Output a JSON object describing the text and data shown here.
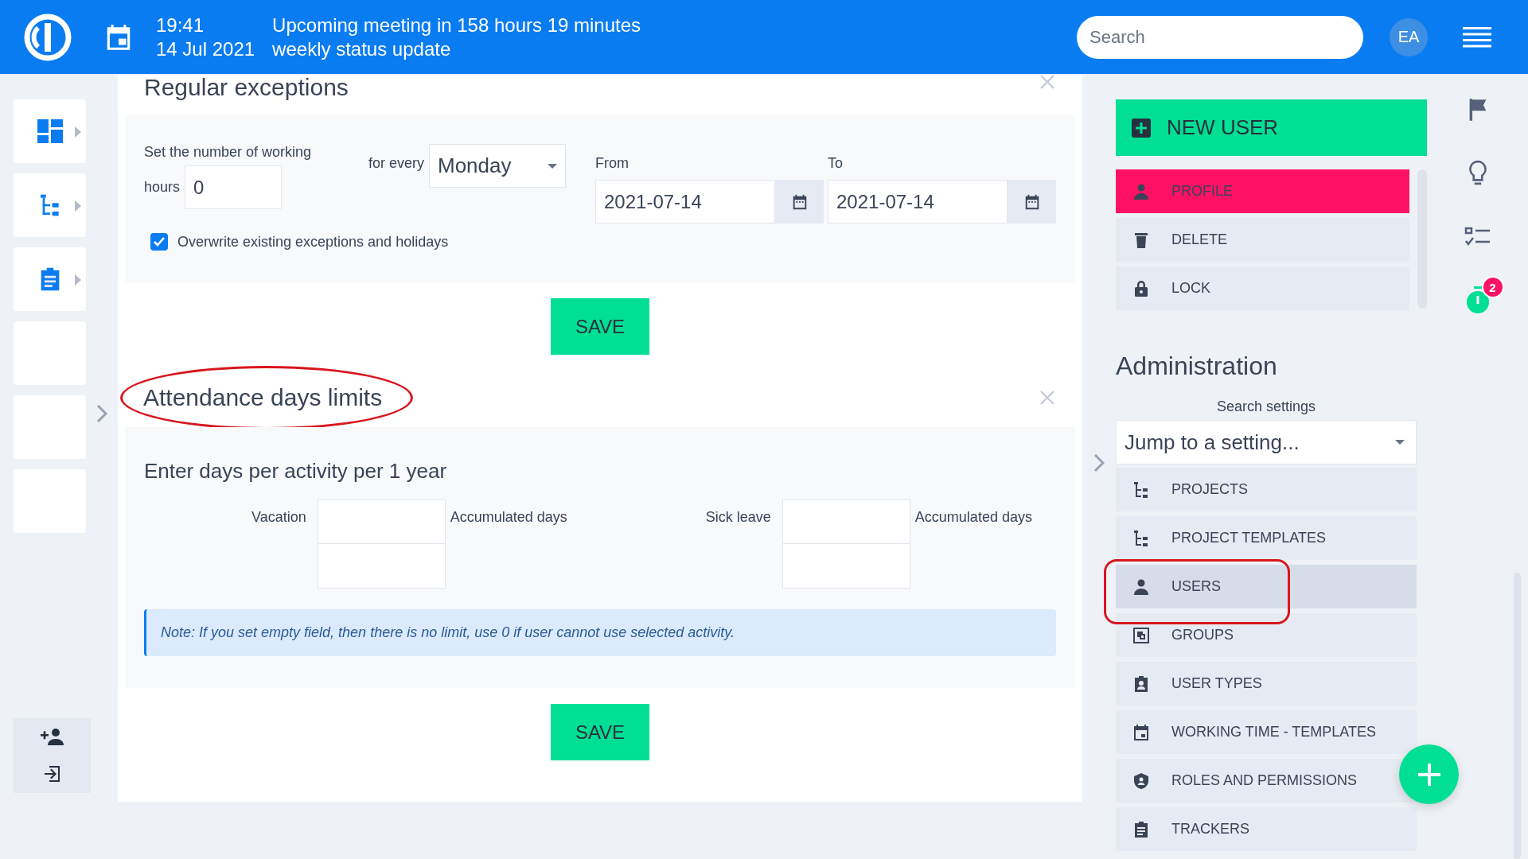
{
  "header": {
    "time": "19:41",
    "meeting": "Upcoming meeting in 158 hours 19 minutes",
    "date": "14 Jul 2021",
    "event": "weekly status update",
    "search": {
      "placeholder": "Search"
    },
    "avatar": "EA"
  },
  "regular_exceptions": {
    "title": "Regular exceptions",
    "hours_label": "Set the number of working",
    "hours_label_2": "hours",
    "hours_value": "0",
    "for_every_label": "for every",
    "day": "Monday",
    "from_label": "From",
    "from_value": "2021-07-14",
    "to_label": "To",
    "to_value": "2021-07-14",
    "overwrite": {
      "label": "Overwrite existing exceptions and holidays",
      "checked": true
    },
    "save": "SAVE"
  },
  "attendance_limits": {
    "title": "Attendance days limits",
    "subtitle": "Enter days per activity per 1 year",
    "fields": [
      {
        "label": "Vacation",
        "accumulated_label": "Accumulated days"
      },
      {
        "label": "Sick leave",
        "accumulated_label": "Accumulated days"
      }
    ],
    "note": "Note: If you set empty field, then there is no limit, use 0 if user cannot use selected activity.",
    "save": "SAVE"
  },
  "user_actions": {
    "new_user": "NEW USER",
    "items": [
      {
        "label": "PROFILE",
        "kind": "person",
        "selected": true
      },
      {
        "label": "DELETE",
        "kind": "trash",
        "selected": false
      },
      {
        "label": "LOCK",
        "kind": "lock",
        "selected": false
      }
    ]
  },
  "administration": {
    "title": "Administration",
    "search_label": "Search settings",
    "jump_value": "Jump to a setting...",
    "items": [
      {
        "label": "PROJECTS",
        "kind": "tree",
        "selected": false
      },
      {
        "label": "PROJECT TEMPLATES",
        "kind": "tree",
        "selected": false
      },
      {
        "label": "USERS",
        "kind": "person",
        "selected": true
      },
      {
        "label": "GROUPS",
        "kind": "group",
        "selected": false
      },
      {
        "label": "USER TYPES",
        "kind": "badge",
        "selected": false
      },
      {
        "label": "WORKING TIME - TEMPLATES",
        "kind": "calendar",
        "selected": false
      },
      {
        "label": "ROLES AND PERMISSIONS",
        "kind": "shield",
        "selected": false
      },
      {
        "label": "TRACKERS",
        "kind": "clipboard",
        "selected": false
      }
    ]
  },
  "timer_badge": "2"
}
